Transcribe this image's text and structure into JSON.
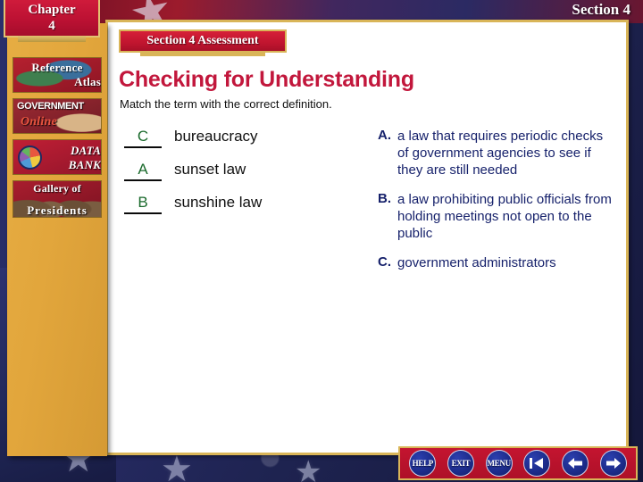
{
  "header": {
    "chapter_line1": "Chapter",
    "chapter_line2": "4",
    "section_label": "Section 4"
  },
  "content": {
    "assessment_title": "Section 4 Assessment",
    "page_title": "Checking for Understanding",
    "instruction": "Match the term with the correct definition."
  },
  "terms": [
    {
      "answer": "C",
      "name": "bureaucracy"
    },
    {
      "answer": "A",
      "name": "sunset law"
    },
    {
      "answer": "B",
      "name": "sunshine law"
    }
  ],
  "definitions": [
    {
      "letter": "A.",
      "text": "a law that requires periodic checks of government agencies to see if they are still needed"
    },
    {
      "letter": "B.",
      "text": "a law prohibiting public officials from holding meetings not open to the public"
    },
    {
      "letter": "C.",
      "text": "government administrators"
    }
  ],
  "sidebar": {
    "atlas_line1": "Reference",
    "atlas_line2": "Atlas",
    "gov_line1": "GOVERNMENT",
    "gov_line2": "Online",
    "data_line1": "DATA",
    "data_line2": "BANK",
    "pres_line1": "Gallery of",
    "pres_line2": "Presidents"
  },
  "navbar": {
    "help": "HELP",
    "exit": "EXIT",
    "menu": "MENU",
    "first_icon": "first-page-icon",
    "back_icon": "back-arrow-icon",
    "forward_icon": "forward-arrow-icon"
  },
  "colors": {
    "crimson": "#c2173c",
    "navy_text": "#16216b",
    "answer_green": "#1a6a2c",
    "gold": "#d9b558",
    "panel_gold": "#e2a63c"
  }
}
